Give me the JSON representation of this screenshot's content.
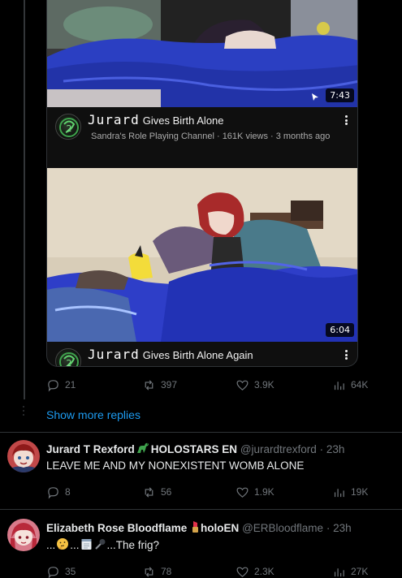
{
  "video1": {
    "duration": "7:43",
    "brand": "Jurard",
    "title": "Gives Birth Alone",
    "meta": "Sandra's Role Playing Channel · 161K views · 3 months ago"
  },
  "video2": {
    "duration": "6:04",
    "brand": "Jurard",
    "title": "Gives Birth Alone Again"
  },
  "post_actions": {
    "replies": "21",
    "reposts": "397",
    "likes": "3.9K",
    "views": "64K"
  },
  "show_more_label": "Show more replies",
  "replies": [
    {
      "name": "Jurard T Rexford",
      "affiliation": "HOLOSTARS EN",
      "handle": "@jurardtrexford",
      "time": "· 23h",
      "text": "LEAVE ME AND MY NONEXISTENT WOMB ALONE",
      "replies": "8",
      "reposts": "56",
      "likes": "1.9K",
      "views": "19K"
    },
    {
      "name": "Elizabeth Rose Bloodflame",
      "affiliation": "holoEN",
      "handle": "@ERBloodflame",
      "time": "· 23h",
      "text_a": "...",
      "text_b": "...",
      "text_c": "...The frig?",
      "replies": "35",
      "reposts": "78",
      "likes": "2.3K",
      "views": "27K"
    }
  ],
  "colors": {
    "link": "#1d9bf0",
    "muted": "#71767b",
    "background": "#000000"
  }
}
